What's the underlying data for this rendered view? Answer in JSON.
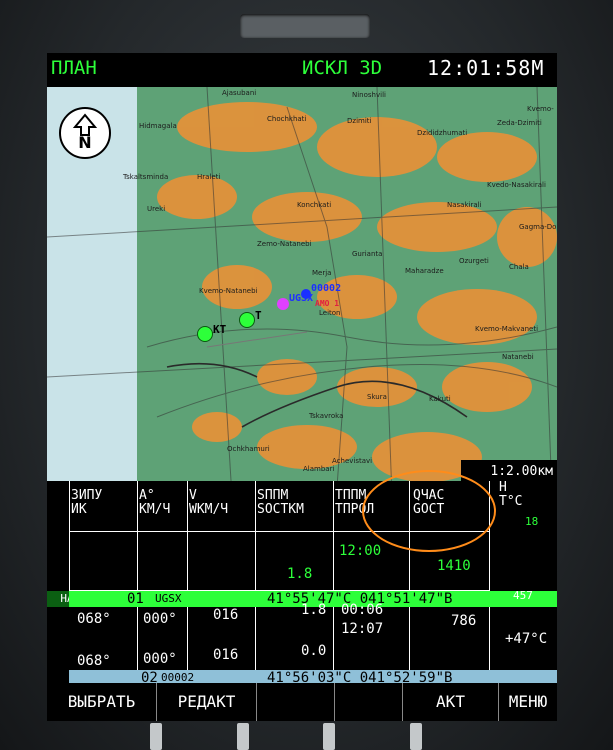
{
  "header": {
    "mode": "ПЛАН",
    "submode": "ИСКЛ 3D",
    "time": "12:01:58М"
  },
  "map": {
    "scale": "1:2.00км",
    "compass_label": "N",
    "towns": [
      "Ajasubani",
      "Ninoshvili",
      "Hidmagala",
      "Chochkhati",
      "Dzimiti",
      "Dzididzhumati",
      "Zeda-Dzimiti",
      "Kvemo-",
      "Tskaltsminda",
      "Hraleti",
      "Kvedo-Nasakirali",
      "Ureki",
      "Konchkati",
      "Nasakirali",
      "Gagma-Do",
      "Zemo-Natanebi",
      "Gurianta",
      "Ozurgeti",
      "Maharadze",
      "Chala",
      "Merja",
      "Kvemo-Natanebi",
      "Leiton",
      "Kvemo-Makvaneti",
      "Natanebi",
      "Skura",
      "Kakuti",
      "Tskavroka",
      "Ochkhamuri",
      "Alambari",
      "Achevistavi"
    ],
    "waypoints": {
      "kt": "КТ",
      "t": "Т",
      "ugsx": "UGSX",
      "wp1": "00002",
      "wp2": "АМО 1"
    }
  },
  "table": {
    "headers": [
      {
        "l1": "ЗИПУ",
        "l2": "ИК"
      },
      {
        "l1": "А°",
        "l2": "КМ/Ч"
      },
      {
        "l1": "V",
        "l2": "WКМ/Ч"
      },
      {
        "l1": "SППМ",
        "l2": "SОСТКМ"
      },
      {
        "l1": "TППМ",
        "l2": "TПРОЛ"
      },
      {
        "l1": "QЧАС",
        "l2": "GОСТ"
      },
      {
        "l1": "Н",
        "l2": "T°С"
      }
    ],
    "row1": {
      "h": "18",
      "sppm": "1.8",
      "tppm": "12:00",
      "qchas": "1410"
    },
    "active_bar": {
      "tag": "НА",
      "num": "01",
      "name": "UGSX",
      "coords": "41°55'47\"С 041°51'47\"В",
      "alt": "457"
    },
    "row2": {
      "course": "068°",
      "a": "000°",
      "v": "016",
      "s": "1.8",
      "t1": "00:06",
      "t2": "12:07",
      "g": "786",
      "temp": "+47°С"
    },
    "row3": {
      "course": "068°",
      "a": "000°",
      "v": "016",
      "s": "0.0"
    },
    "next_bar": {
      "num": "02",
      "name": "00002",
      "coords": "41°56'03\"С 041°52'59\"В"
    }
  },
  "softkeys": [
    "ВЫБРАТЬ",
    "РЕДАКТ",
    "",
    "",
    "АКТ",
    "МЕНЮ"
  ]
}
